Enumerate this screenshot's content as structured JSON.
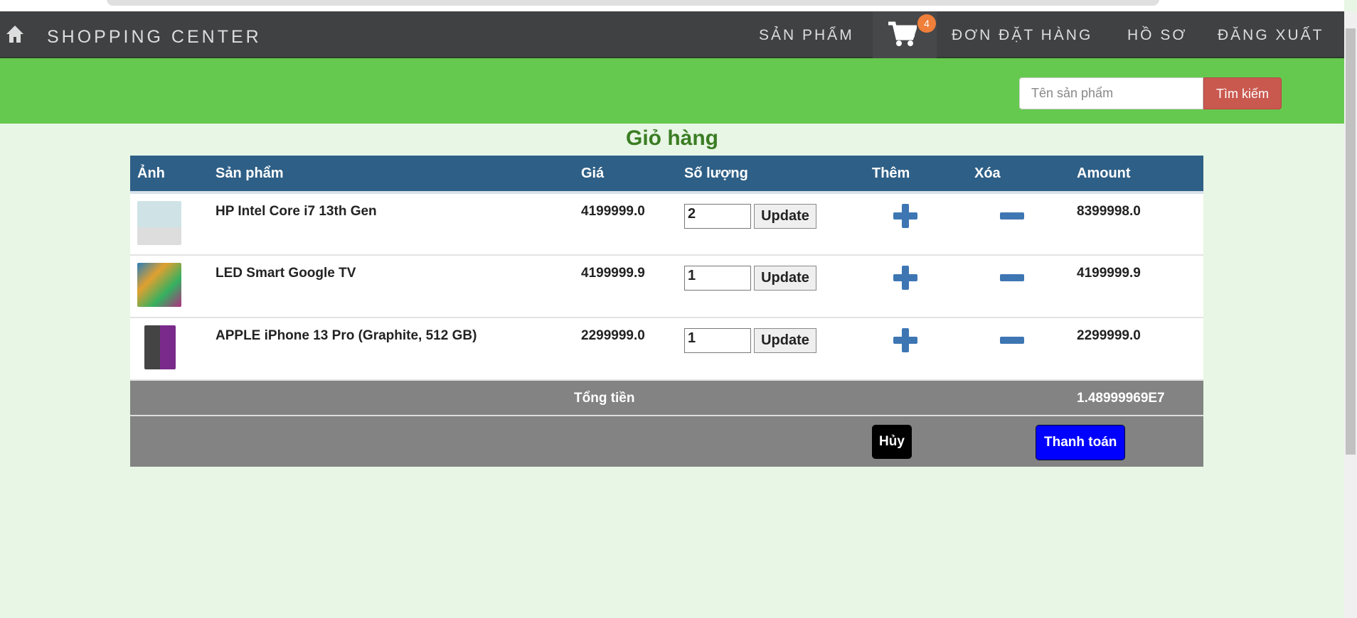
{
  "nav": {
    "brand": "SHOPPING CENTER",
    "products": "SẢN PHẨM",
    "cart_count": "4",
    "orders": "ĐƠN ĐẶT HÀNG",
    "profile": "HỒ SƠ",
    "logout": "ĐĂNG XUẤT"
  },
  "search": {
    "placeholder": "Tên sản phẩm",
    "button": "Tìm kiếm"
  },
  "title": "Giỏ hàng",
  "table": {
    "headers": [
      "Ảnh",
      "Sản phẩm",
      "Giá",
      "Số lượng",
      "Thêm",
      "Xóa",
      "Amount"
    ],
    "rows": [
      {
        "name": "HP Intel Core i7 13th Gen",
        "price": "4199999.0",
        "qty": "2",
        "amount": "8399998.0"
      },
      {
        "name": "LED Smart Google TV",
        "price": "4199999.9",
        "qty": "1",
        "amount": "4199999.9"
      },
      {
        "name": "APPLE iPhone 13 Pro (Graphite, 512 GB)",
        "price": "2299999.0",
        "qty": "1",
        "amount": "2299999.0"
      }
    ],
    "update_label": "Update",
    "total_label": "Tổng tiền",
    "total": "1.48999969E7",
    "cancel": "Hủy",
    "checkout": "Thanh toán"
  }
}
